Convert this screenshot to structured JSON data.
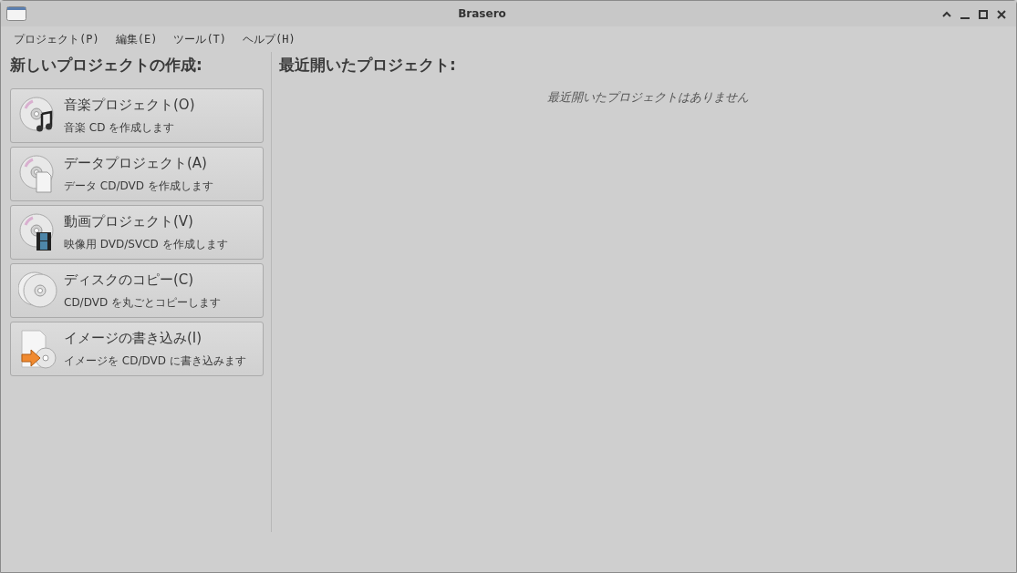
{
  "window": {
    "title": "Brasero"
  },
  "menu": [
    "プロジェクト(P)",
    "編集(E)",
    "ツール(T)",
    "ヘルプ(H)"
  ],
  "new_project": {
    "heading": "新しいプロジェクトの作成:",
    "buttons": [
      {
        "kind": "audio",
        "label": "音楽プロジェクト(O)",
        "description": "音楽 CD を作成します"
      },
      {
        "kind": "data",
        "label": "データプロジェクト(A)",
        "description": "データ CD/DVD を作成します"
      },
      {
        "kind": "video",
        "label": "動画プロジェクト(V)",
        "description": "映像用 DVD/SVCD を作成します"
      },
      {
        "kind": "copy",
        "label": "ディスクのコピー(C)",
        "description": "CD/DVD を丸ごとコピーします"
      },
      {
        "kind": "image",
        "label": "イメージの書き込み(I)",
        "description": "イメージを CD/DVD に書き込みます"
      }
    ]
  },
  "recent_projects": {
    "heading": "最近開いたプロジェクト:",
    "empty_message": "最近開いたプロジェクトはありません"
  }
}
